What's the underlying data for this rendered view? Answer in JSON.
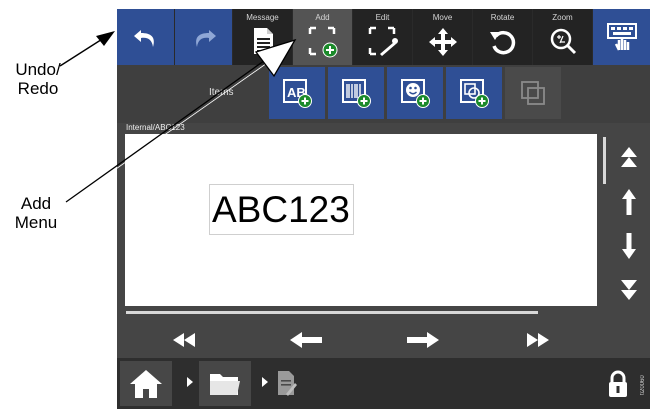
{
  "annotations": {
    "undo_redo": [
      "Undo/",
      "Redo"
    ],
    "add_menu": [
      "Add",
      "Menu"
    ]
  },
  "toolbar": {
    "undo_icon": "undo-icon",
    "redo_icon": "redo-icon",
    "message_label": "Message",
    "add_label": "Add",
    "edit_label": "Edit",
    "move_label": "Move",
    "rotate_label": "Rotate",
    "zoom_label": "Zoom",
    "keyboard_icon": "keyboard-touch-icon",
    "active_tab": "Add"
  },
  "items_bar": {
    "label": "Items",
    "buttons": [
      "add-text-icon",
      "add-barcode-icon",
      "add-graphic-icon",
      "add-shape-icon",
      "group-icon"
    ]
  },
  "message_path": "Internal/ABC123",
  "canvas": {
    "text_object": "ABC123"
  },
  "bottom": {
    "ref_code": "ti20060"
  },
  "colors": {
    "button_blue": "#2f4f95",
    "toolbar_dark": "#2a2a2a",
    "active_tab": "#545454",
    "panel_gray": "#454545",
    "add_badge_green": "#1a8a2a"
  }
}
